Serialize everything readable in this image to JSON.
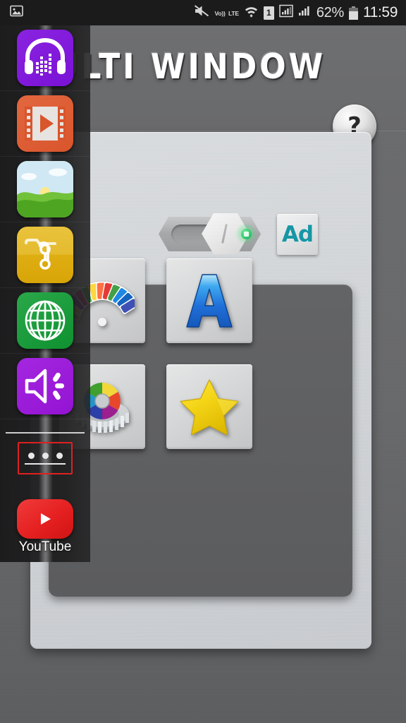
{
  "statusbar": {
    "left_icon": "photo-icon",
    "icons": [
      "mute-icon",
      "volte-icon",
      "wifi-icon",
      "sim1-icon",
      "signal1-icon",
      "signal2-icon"
    ],
    "volte_top": "Vo))",
    "volte_bottom": "LTE",
    "sim_label": "1",
    "battery_percent": "62%",
    "battery_level": 62,
    "clock": "11:59"
  },
  "header": {
    "title": "MULTI WINDOW",
    "help_label": "?"
  },
  "controls": {
    "toggle": {
      "name": "enable-toggle",
      "state": "on",
      "badge_icon": "android-robot-icon"
    },
    "ad_button": {
      "label": "Ad",
      "color": "#1296a4"
    }
  },
  "grid": {
    "tiles": [
      {
        "name": "color-swatch-fan-tile",
        "icon": "color-palette-fan-icon"
      },
      {
        "name": "font-letter-tile",
        "icon": "letter-a-icon",
        "label": "A"
      },
      {
        "name": "color-wheel-gear-tile",
        "icon": "color-wheel-gear-icon"
      },
      {
        "name": "favorite-star-tile",
        "icon": "star-icon"
      }
    ]
  },
  "sidebar": {
    "items": [
      {
        "name": "sidebar-item-music",
        "icon": "headphones-equalizer-icon",
        "label": ""
      },
      {
        "name": "sidebar-item-video",
        "icon": "film-play-icon",
        "label": ""
      },
      {
        "name": "sidebar-item-gallery",
        "icon": "landscape-photo-icon",
        "label": ""
      },
      {
        "name": "sidebar-item-files",
        "icon": "folder-safety-pin-icon",
        "label": ""
      },
      {
        "name": "sidebar-item-browser",
        "icon": "globe-icon",
        "label": ""
      },
      {
        "name": "sidebar-item-sound",
        "icon": "speaker-volume-icon",
        "label": ""
      }
    ],
    "more_button": {
      "name": "more-apps-button",
      "icon": "three-dots-icon",
      "outline_color": "#e02020"
    },
    "youtube": {
      "name": "sidebar-item-youtube",
      "icon": "youtube-play-icon",
      "label": "YouTube"
    }
  },
  "colors": {
    "accent_teal": "#1296a4",
    "toggle_on_green": "#2fc96d",
    "highlight_red": "#e02020",
    "panel_light": "#d6d9dc",
    "panel_dark": "#5f6062"
  }
}
